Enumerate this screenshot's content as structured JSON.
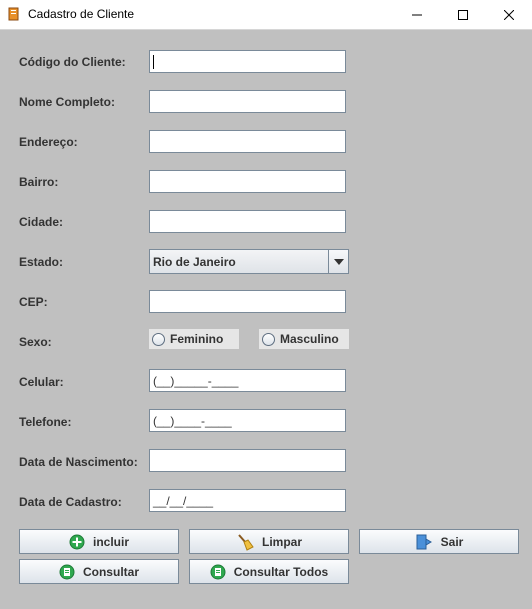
{
  "window": {
    "title": "Cadastro de Cliente",
    "controls": [
      "minimize",
      "maximize",
      "close"
    ]
  },
  "form": {
    "fields": [
      {
        "label": "Código do Cliente:",
        "value": ""
      },
      {
        "label": "Nome Completo:",
        "value": ""
      },
      {
        "label": "Endereço:",
        "value": ""
      },
      {
        "label": "Bairro:",
        "value": ""
      },
      {
        "label": "Cidade:",
        "value": ""
      },
      {
        "label": "Estado:",
        "value": "Rio de Janeiro"
      },
      {
        "label": "CEP:",
        "value": ""
      },
      {
        "label": "Sexo:"
      },
      {
        "label": "Celular:",
        "value": "(__)_____-____"
      },
      {
        "label": "Telefone:",
        "value": "(__)____-____"
      },
      {
        "label": "Data de Nascimento:",
        "value": ""
      },
      {
        "label": "Data de Cadastro:",
        "value": "__/__/____"
      }
    ],
    "sexo_options": [
      "Feminino",
      "Masculino"
    ]
  },
  "buttons": {
    "incluir": "incluir",
    "limpar": "Limpar",
    "sair": "Sair",
    "consultar": "Consultar",
    "consultar_todos": "Consultar Todos"
  },
  "icons": {
    "incluir": "green-plus-icon",
    "limpar": "broom-icon",
    "sair": "exit-door-icon",
    "consultar": "green-document-icon",
    "consultar_todos": "green-document-icon"
  },
  "colors": {
    "background": "#c0c0c0",
    "label_text": "#333333",
    "green_icon": "#2fa84f"
  }
}
